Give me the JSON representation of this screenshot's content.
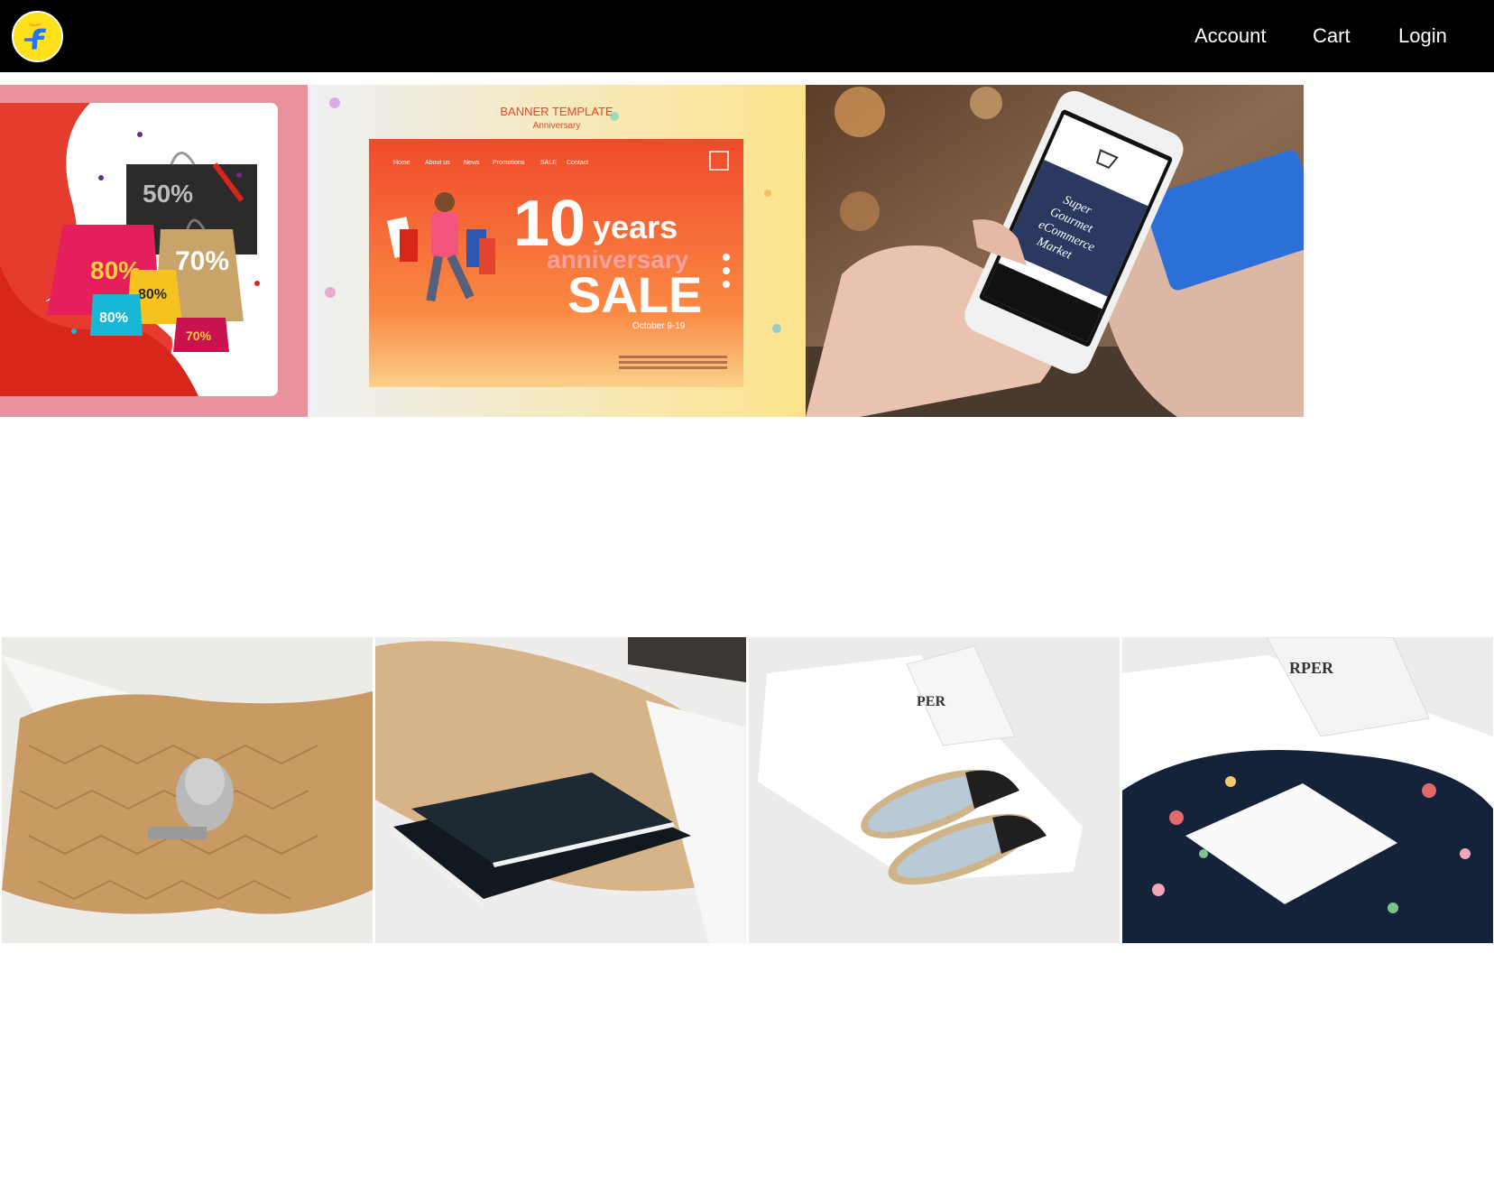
{
  "nav": {
    "logo_icon": "flipkart-logo-icon",
    "account_label": "Account",
    "cart_label": "Cart",
    "login_label": "Login"
  },
  "banners": [
    {
      "badges": [
        "50%",
        "80%",
        "70%",
        "80%",
        "80%",
        "70%"
      ]
    },
    {
      "heading": "BANNER TEMPLATE",
      "subheading": "Anniversary",
      "menu": [
        "Home",
        "About us",
        "News",
        "Promotions",
        "SALE",
        "Contact"
      ],
      "big_number": "10",
      "years": "years",
      "anniversary": "anniversary",
      "sale": "SALE",
      "date": "October 9-19"
    },
    {
      "screen_text": [
        "Super",
        "Gourmet",
        "eCommerce",
        "Market"
      ]
    }
  ],
  "products": [
    {
      "icon": "buddha-statue-icon"
    },
    {
      "icon": "notebook-icon"
    },
    {
      "icon": "espadrilles-icon",
      "box_text": "PER"
    },
    {
      "icon": "scarf-icon",
      "box_text": "RPER"
    }
  ],
  "colors": {
    "header_bg": "#000000",
    "nav_text": "#ffffff",
    "logo_yellow": "#ffe11b",
    "logo_blue": "#2874f0",
    "sale_red": "#f04a2a"
  }
}
